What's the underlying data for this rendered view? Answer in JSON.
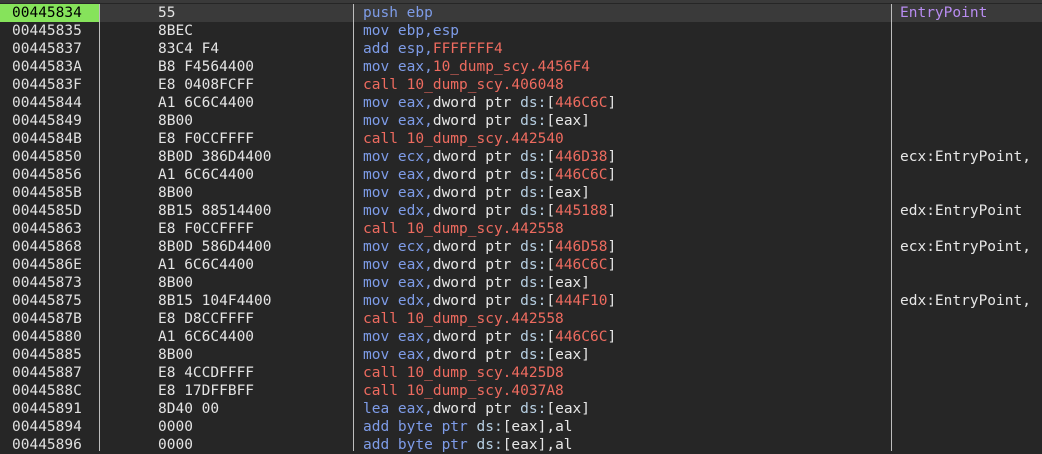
{
  "disassembly": {
    "rows": [
      {
        "address": "00445834",
        "bytes": "55",
        "instruction": [
          {
            "t": "push ebp",
            "c": "mn"
          }
        ],
        "comment": "EntryPoint",
        "ip": true
      },
      {
        "address": "00445835",
        "bytes": "8BEC",
        "instruction": [
          {
            "t": "mov ebp,esp",
            "c": "mn"
          }
        ],
        "comment": ""
      },
      {
        "address": "00445837",
        "bytes": "83C4 F4",
        "instruction": [
          {
            "t": "add esp,",
            "c": "mn"
          },
          {
            "t": "FFFFFFF4",
            "c": "num"
          }
        ],
        "comment": ""
      },
      {
        "address": "0044583A",
        "bytes": "B8 F4564400",
        "instruction": [
          {
            "t": "mov eax,",
            "c": "mn"
          },
          {
            "t": "10_dump_scy.4456F4",
            "c": "num"
          }
        ],
        "comment": ""
      },
      {
        "address": "0044583F",
        "bytes": "E8 0408FCFF",
        "instruction": [
          {
            "t": "call 10_dump_scy.406048",
            "c": "call"
          }
        ],
        "comment": ""
      },
      {
        "address": "00445844",
        "bytes": "A1 6C6C4400",
        "instruction": [
          {
            "t": "mov eax,",
            "c": "mn"
          },
          {
            "t": "dword ptr ",
            "c": "kw"
          },
          {
            "t": "ds:",
            "c": "ds"
          },
          {
            "t": "[",
            "c": "br"
          },
          {
            "t": "446C6C",
            "c": "num"
          },
          {
            "t": "]",
            "c": "br"
          }
        ],
        "comment": ""
      },
      {
        "address": "00445849",
        "bytes": "8B00",
        "instruction": [
          {
            "t": "mov eax,",
            "c": "mn"
          },
          {
            "t": "dword ptr ",
            "c": "kw"
          },
          {
            "t": "ds:",
            "c": "ds"
          },
          {
            "t": "[eax]",
            "c": "br"
          }
        ],
        "comment": ""
      },
      {
        "address": "0044584B",
        "bytes": "E8 F0CCFFFF",
        "instruction": [
          {
            "t": "call 10_dump_scy.442540",
            "c": "call"
          }
        ],
        "comment": ""
      },
      {
        "address": "00445850",
        "bytes": "8B0D 386D4400",
        "instruction": [
          {
            "t": "mov ecx,",
            "c": "mn"
          },
          {
            "t": "dword ptr ",
            "c": "kw"
          },
          {
            "t": "ds:",
            "c": "ds"
          },
          {
            "t": "[",
            "c": "br"
          },
          {
            "t": "446D38",
            "c": "num"
          },
          {
            "t": "]",
            "c": "br"
          }
        ],
        "comment": "ecx:EntryPoint,"
      },
      {
        "address": "00445856",
        "bytes": "A1 6C6C4400",
        "instruction": [
          {
            "t": "mov eax,",
            "c": "mn"
          },
          {
            "t": "dword ptr ",
            "c": "kw"
          },
          {
            "t": "ds:",
            "c": "ds"
          },
          {
            "t": "[",
            "c": "br"
          },
          {
            "t": "446C6C",
            "c": "num"
          },
          {
            "t": "]",
            "c": "br"
          }
        ],
        "comment": ""
      },
      {
        "address": "0044585B",
        "bytes": "8B00",
        "instruction": [
          {
            "t": "mov eax,",
            "c": "mn"
          },
          {
            "t": "dword ptr ",
            "c": "kw"
          },
          {
            "t": "ds:",
            "c": "ds"
          },
          {
            "t": "[eax]",
            "c": "br"
          }
        ],
        "comment": ""
      },
      {
        "address": "0044585D",
        "bytes": "8B15 88514400",
        "instruction": [
          {
            "t": "mov edx,",
            "c": "mn"
          },
          {
            "t": "dword ptr ",
            "c": "kw"
          },
          {
            "t": "ds:",
            "c": "ds"
          },
          {
            "t": "[",
            "c": "br"
          },
          {
            "t": "445188",
            "c": "num"
          },
          {
            "t": "]",
            "c": "br"
          }
        ],
        "comment": "edx:EntryPoint"
      },
      {
        "address": "00445863",
        "bytes": "E8 F0CCFFFF",
        "instruction": [
          {
            "t": "call 10_dump_scy.442558",
            "c": "call"
          }
        ],
        "comment": ""
      },
      {
        "address": "00445868",
        "bytes": "8B0D 586D4400",
        "instruction": [
          {
            "t": "mov ecx,",
            "c": "mn"
          },
          {
            "t": "dword ptr ",
            "c": "kw"
          },
          {
            "t": "ds:",
            "c": "ds"
          },
          {
            "t": "[",
            "c": "br"
          },
          {
            "t": "446D58",
            "c": "num"
          },
          {
            "t": "]",
            "c": "br"
          }
        ],
        "comment": "ecx:EntryPoint,"
      },
      {
        "address": "0044586E",
        "bytes": "A1 6C6C4400",
        "instruction": [
          {
            "t": "mov eax,",
            "c": "mn"
          },
          {
            "t": "dword ptr ",
            "c": "kw"
          },
          {
            "t": "ds:",
            "c": "ds"
          },
          {
            "t": "[",
            "c": "br"
          },
          {
            "t": "446C6C",
            "c": "num"
          },
          {
            "t": "]",
            "c": "br"
          }
        ],
        "comment": ""
      },
      {
        "address": "00445873",
        "bytes": "8B00",
        "instruction": [
          {
            "t": "mov eax,",
            "c": "mn"
          },
          {
            "t": "dword ptr ",
            "c": "kw"
          },
          {
            "t": "ds:",
            "c": "ds"
          },
          {
            "t": "[eax]",
            "c": "br"
          }
        ],
        "comment": ""
      },
      {
        "address": "00445875",
        "bytes": "8B15 104F4400",
        "instruction": [
          {
            "t": "mov edx,",
            "c": "mn"
          },
          {
            "t": "dword ptr ",
            "c": "kw"
          },
          {
            "t": "ds:",
            "c": "ds"
          },
          {
            "t": "[",
            "c": "br"
          },
          {
            "t": "444F10",
            "c": "num"
          },
          {
            "t": "]",
            "c": "br"
          }
        ],
        "comment": "edx:EntryPoint,"
      },
      {
        "address": "0044587B",
        "bytes": "E8 D8CCFFFF",
        "instruction": [
          {
            "t": "call 10_dump_scy.442558",
            "c": "call"
          }
        ],
        "comment": ""
      },
      {
        "address": "00445880",
        "bytes": "A1 6C6C4400",
        "instruction": [
          {
            "t": "mov eax,",
            "c": "mn"
          },
          {
            "t": "dword ptr ",
            "c": "kw"
          },
          {
            "t": "ds:",
            "c": "ds"
          },
          {
            "t": "[",
            "c": "br"
          },
          {
            "t": "446C6C",
            "c": "num"
          },
          {
            "t": "]",
            "c": "br"
          }
        ],
        "comment": ""
      },
      {
        "address": "00445885",
        "bytes": "8B00",
        "instruction": [
          {
            "t": "mov eax,",
            "c": "mn"
          },
          {
            "t": "dword ptr ",
            "c": "kw"
          },
          {
            "t": "ds:",
            "c": "ds"
          },
          {
            "t": "[eax]",
            "c": "br"
          }
        ],
        "comment": ""
      },
      {
        "address": "00445887",
        "bytes": "E8 4CCDFFFF",
        "instruction": [
          {
            "t": "call 10_dump_scy.4425D8",
            "c": "call"
          }
        ],
        "comment": ""
      },
      {
        "address": "0044588C",
        "bytes": "E8 17DFFBFF",
        "instruction": [
          {
            "t": "call 10_dump_scy.4037A8",
            "c": "call"
          }
        ],
        "comment": ""
      },
      {
        "address": "00445891",
        "bytes": "8D40 00",
        "instruction": [
          {
            "t": "lea eax,",
            "c": "mn"
          },
          {
            "t": "dword ptr ",
            "c": "kw"
          },
          {
            "t": "ds:",
            "c": "ds"
          },
          {
            "t": "[eax]",
            "c": "br"
          }
        ],
        "comment": ""
      },
      {
        "address": "00445894",
        "bytes": "0000",
        "instruction": [
          {
            "t": "add byte ptr ",
            "c": "mn"
          },
          {
            "t": "ds:",
            "c": "ds"
          },
          {
            "t": "[eax],al",
            "c": "br"
          }
        ],
        "comment": ""
      },
      {
        "address": "00445896",
        "bytes": "0000",
        "instruction": [
          {
            "t": "add byte ptr ",
            "c": "mn"
          },
          {
            "t": "ds:",
            "c": "ds"
          },
          {
            "t": "[eax],al",
            "c": "br"
          }
        ],
        "comment": ""
      }
    ]
  }
}
